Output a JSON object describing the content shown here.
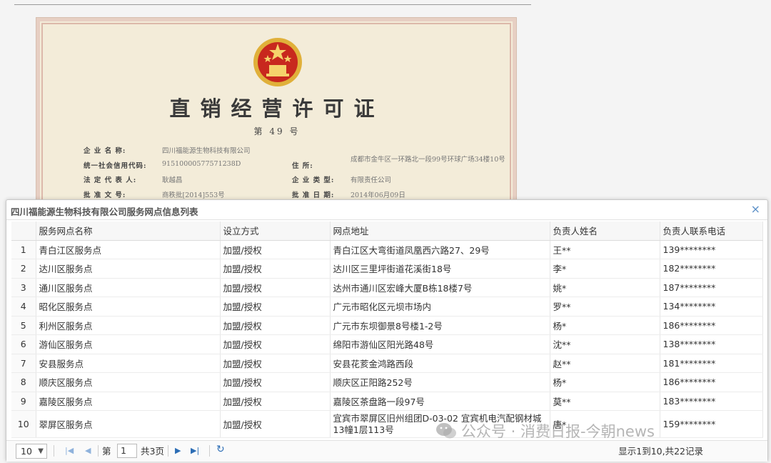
{
  "certificate": {
    "title": "直销经营许可证",
    "number": "第 49 号",
    "fields": [
      {
        "label": "企 业 名 称:",
        "value": "四川福能源生物科技有限公司"
      },
      {
        "label": "统一社会信用代码:",
        "value": "91510000577571238D"
      },
      {
        "label": "住 所:",
        "value": "成都市金牛区一环路北一段99号环球广场34楼10号"
      },
      {
        "label": "法 定 代 表 人:",
        "value": "耿越昌"
      },
      {
        "label": "企 业 类 型:",
        "value": "有限责任公司"
      },
      {
        "label": "批 准 文 号:",
        "value": "商秩批[2014]553号"
      },
      {
        "label": "批 准 日 期:",
        "value": "2014年06月09日"
      }
    ]
  },
  "dialog": {
    "title": "四川福能源生物科技有限公司服务网点信息列表",
    "close_glyph": "×",
    "columns": [
      "",
      "服务网点名称",
      "设立方式",
      "网点地址",
      "负责人姓名",
      "负责人联系电话"
    ],
    "rows": [
      {
        "no": "1",
        "name": "青白江区服务点",
        "mode": "加盟/授权",
        "address": "青白江区大弯街道凤凰西六路27、29号",
        "person": "王**",
        "phone": "139********"
      },
      {
        "no": "2",
        "name": "达川区服务点",
        "mode": "加盟/授权",
        "address": "达川区三里坪街道花溪街18号",
        "person": "李*",
        "phone": "182********"
      },
      {
        "no": "3",
        "name": "通川区服务点",
        "mode": "加盟/授权",
        "address": "达州市通川区宏峰大厦B栋18楼7号",
        "person": "姚*",
        "phone": "187********"
      },
      {
        "no": "4",
        "name": "昭化区服务点",
        "mode": "加盟/授权",
        "address": "广元市昭化区元坝市场内",
        "person": "罗**",
        "phone": "134********"
      },
      {
        "no": "5",
        "name": "利州区服务点",
        "mode": "加盟/授权",
        "address": "广元市东坝御景8号楼1-2号",
        "person": "杨*",
        "phone": "186********"
      },
      {
        "no": "6",
        "name": "游仙区服务点",
        "mode": "加盟/授权",
        "address": "绵阳市游仙区阳光路48号",
        "person": "沈**",
        "phone": "138********"
      },
      {
        "no": "7",
        "name": "安县服务点",
        "mode": "加盟/授权",
        "address": "安县花荄金鸿路西段",
        "person": "赵**",
        "phone": "181********"
      },
      {
        "no": "8",
        "name": "顺庆区服务点",
        "mode": "加盟/授权",
        "address": "顺庆区正阳路252号",
        "person": "杨*",
        "phone": "186********"
      },
      {
        "no": "9",
        "name": "嘉陵区服务点",
        "mode": "加盟/授权",
        "address": "嘉陵区茶盘路一段97号",
        "person": "莫**",
        "phone": "183********"
      },
      {
        "no": "10",
        "name": "翠屏区服务点",
        "mode": "加盟/授权",
        "address": "宜宾市翠屏区旧州组团D-03-02 宜宾机电汽配钢材城13幢1层113号",
        "person": "唐*",
        "phone": "159********"
      }
    ],
    "pager": {
      "page_size": "10",
      "page_prefix": "第",
      "page_value": "1",
      "page_suffix": "共3页",
      "info": "显示1到10,共22记录",
      "icons": {
        "first": "first-page-icon",
        "prev": "prev-page-icon",
        "next": "next-page-icon",
        "last": "last-page-icon",
        "refresh": "refresh-icon"
      }
    }
  },
  "watermark": {
    "text": "公众号 · 消费日报-今朝news"
  },
  "colors": {
    "accent": "#2c6db5",
    "emblem_red": "#c8281e",
    "emblem_gold": "#e0b03a"
  }
}
